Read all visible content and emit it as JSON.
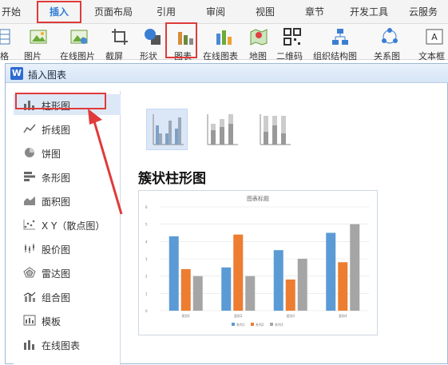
{
  "menubar": {
    "items": [
      "开始",
      "插入",
      "页面布局",
      "引用",
      "审阅",
      "视图",
      "章节",
      "开发工具",
      "云服务"
    ],
    "active_index": 1
  },
  "ribbon": {
    "items": [
      {
        "label": "格",
        "icon": "table-icon"
      },
      {
        "label": "图片",
        "icon": "picture-icon"
      },
      {
        "label": "在线图片",
        "icon": "online-picture-icon"
      },
      {
        "label": "截屏",
        "icon": "screenshot-icon"
      },
      {
        "label": "形状",
        "icon": "shape-icon"
      },
      {
        "label": "图表",
        "icon": "chart-icon"
      },
      {
        "label": "在线图表",
        "icon": "online-chart-icon"
      },
      {
        "label": "地图",
        "icon": "map-icon"
      },
      {
        "label": "二维码",
        "icon": "qrcode-icon"
      },
      {
        "label": "组织结构图",
        "icon": "org-chart-icon"
      },
      {
        "label": "关系图",
        "icon": "relation-icon"
      },
      {
        "label": "文本框",
        "icon": "textbox-icon"
      }
    ]
  },
  "dialog": {
    "title": "插入图表",
    "logo": "W",
    "categories": [
      {
        "label": "柱形图",
        "icon": "column-chart-icon"
      },
      {
        "label": "折线图",
        "icon": "line-chart-icon"
      },
      {
        "label": "饼图",
        "icon": "pie-chart-icon"
      },
      {
        "label": "条形图",
        "icon": "bar-chart-icon"
      },
      {
        "label": "面积图",
        "icon": "area-chart-icon"
      },
      {
        "label": "X Y（散点图）",
        "icon": "scatter-chart-icon"
      },
      {
        "label": "股价图",
        "icon": "stock-chart-icon"
      },
      {
        "label": "雷达图",
        "icon": "radar-chart-icon"
      },
      {
        "label": "组合图",
        "icon": "combo-chart-icon"
      },
      {
        "label": "模板",
        "icon": "template-icon"
      },
      {
        "label": "在线图表",
        "icon": "online-chart-icon"
      }
    ],
    "selected_category": 0,
    "subtype_selected": 0,
    "subtype_title": "簇状柱形图"
  },
  "chart_data": {
    "type": "bar",
    "title": "图表标题",
    "categories": [
      "类别1",
      "类别2",
      "类别3",
      "类别4"
    ],
    "series": [
      {
        "name": "系列1",
        "values": [
          4.3,
          2.5,
          3.5,
          4.5
        ],
        "color": "#5b9bd5"
      },
      {
        "name": "系列2",
        "values": [
          2.4,
          4.4,
          1.8,
          2.8
        ],
        "color": "#ed7d31"
      },
      {
        "name": "系列3",
        "values": [
          2.0,
          2.0,
          3.0,
          5.0
        ],
        "color": "#a5a5a5"
      }
    ],
    "ylim": [
      0,
      6
    ],
    "yticks": [
      "0",
      "1",
      "2",
      "3",
      "4",
      "5",
      "6"
    ],
    "grid": true,
    "legend": "bottom"
  },
  "colors": {
    "accent": "#2b7bd8",
    "highlight_red": "#e03a3a"
  }
}
